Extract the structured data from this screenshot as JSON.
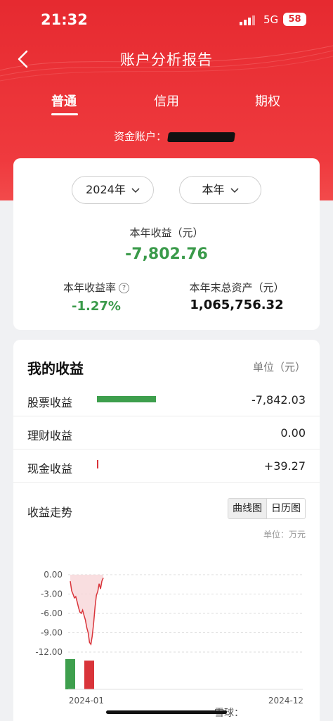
{
  "status_bar": {
    "time": "21:32",
    "network": "5G",
    "battery": "58"
  },
  "nav": {
    "title": "账户分析报告"
  },
  "tabs": [
    {
      "label": "普通",
      "active": true
    },
    {
      "label": "信用",
      "active": false
    },
    {
      "label": "期权",
      "active": false
    }
  ],
  "account": {
    "label": "资金账户："
  },
  "summary": {
    "year_select": "2024年",
    "period_select": "本年",
    "profit_label": "本年收益（元）",
    "profit_value": "-7,802.76",
    "rate_label": "本年收益率",
    "rate_help": "?",
    "rate_value": "-1.27%",
    "assets_label": "本年末总资产（元）",
    "assets_value": "1,065,756.32"
  },
  "my_income": {
    "title": "我的收益",
    "unit": "单位（元）",
    "rows": [
      {
        "name": "股票收益",
        "value": "-7,842.03",
        "bar_fraction": 1.0,
        "bar_color": "#3e9f4d"
      },
      {
        "name": "理财收益",
        "value": "0.00",
        "bar_fraction": 0,
        "bar_color": "#3e9f4d"
      },
      {
        "name": "现金收益",
        "value": "+39.27",
        "bar_fraction": 0.005,
        "bar_color": "#d9343a"
      }
    ]
  },
  "trend": {
    "title": "收益走势",
    "toggle": [
      "曲线图",
      "日历图"
    ],
    "toggle_active": 0,
    "unit": "单位：万元"
  },
  "chart_data": {
    "type": "area",
    "yticks": [
      "0.00",
      "-3.00",
      "-6.00",
      "-9.00",
      "-12.00"
    ],
    "ylim": [
      -12,
      0
    ],
    "xlabels": [
      "2024-01",
      "2024-12"
    ],
    "series": [
      {
        "values": [
          -1.0,
          -2.5,
          -3.0,
          -3.6,
          -3.4,
          -4.2,
          -5.1,
          -5.8,
          -6.0,
          -5.5,
          -6.3,
          -7.0,
          -8.2,
          -9.0,
          -10.5,
          -10.8,
          -9.5,
          -7.5,
          -5.0,
          -3.2,
          -2.6,
          -1.4,
          -2.2,
          -1.0,
          -0.5
        ]
      }
    ],
    "bars": [
      {
        "color": "#3e9f4d",
        "value": 1.0
      },
      {
        "color": "#d9343a",
        "value": 0.95
      }
    ]
  },
  "watermark": "雪球：yyyyyymmmmmmm"
}
